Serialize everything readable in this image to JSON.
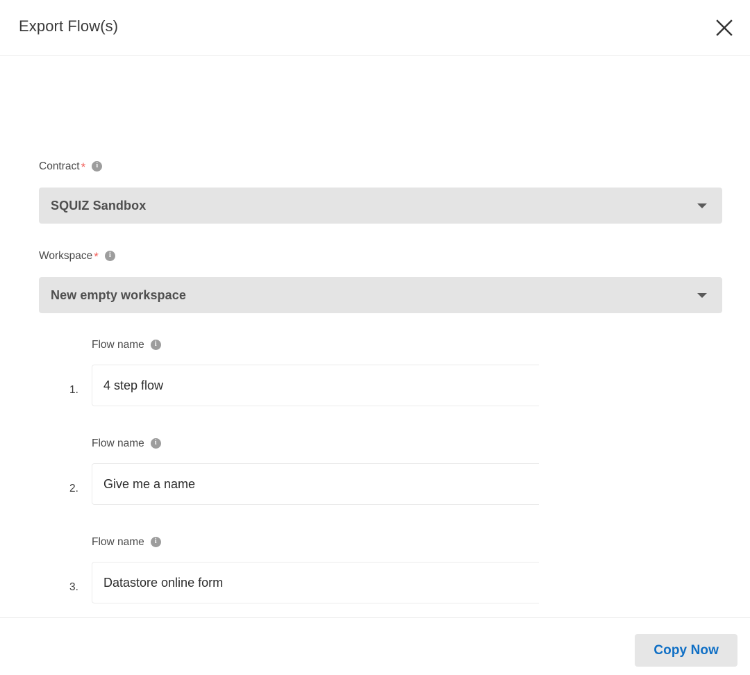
{
  "dialog": {
    "title": "Export Flow(s)",
    "close_icon": "close-icon"
  },
  "form": {
    "contract": {
      "label": "Contract",
      "required_marker": "*",
      "info_icon": "info-icon",
      "selected_value": "SQUIZ Sandbox",
      "dropdown_icon": "chevron-down-icon"
    },
    "workspace": {
      "label": "Workspace",
      "required_marker": "*",
      "info_icon": "info-icon",
      "selected_value": "New empty workspace",
      "dropdown_icon": "chevron-down-icon"
    },
    "flows": [
      {
        "index": "1.",
        "label": "Flow name",
        "info_icon": "info-icon",
        "value": "4 step flow"
      },
      {
        "index": "2.",
        "label": "Flow name",
        "info_icon": "info-icon",
        "value": "Give me a name"
      },
      {
        "index": "3.",
        "label": "Flow name",
        "info_icon": "info-icon",
        "value": "Datastore online form"
      }
    ]
  },
  "footer": {
    "copy_label": "Copy Now"
  },
  "colors": {
    "accent_blue": "#0f6fc5",
    "required_red": "#f2615c",
    "select_bg": "#e4e4e4",
    "button_bg": "#e6e6e6",
    "info_icon_bg": "#9d9d9d"
  }
}
